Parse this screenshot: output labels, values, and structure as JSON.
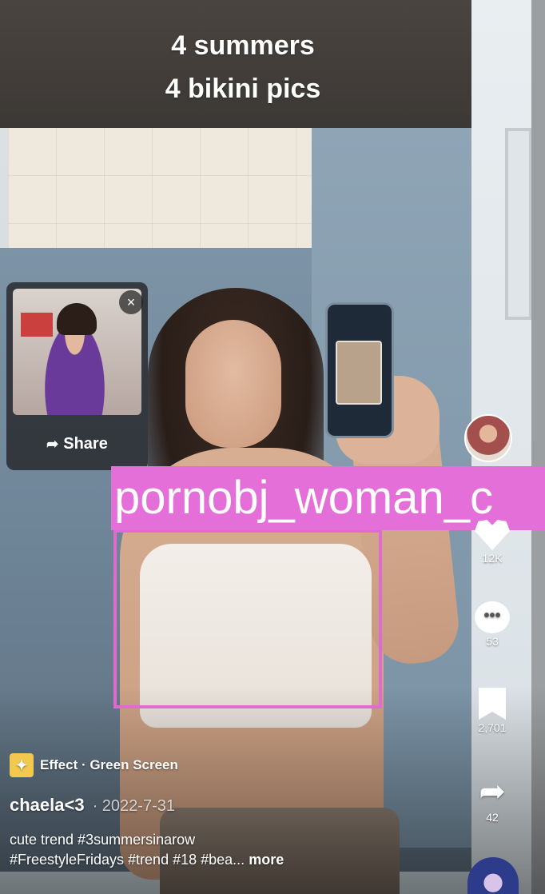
{
  "video": {
    "caption_line1": "4 summers",
    "caption_line2": "4 bikini pics"
  },
  "share_card": {
    "close_icon": "close-icon",
    "close_glyph": "×",
    "button_label": "Share",
    "button_icon": "share-arrow-icon"
  },
  "detection": {
    "label": "pornobj_woman_c",
    "color": "#e56fd8"
  },
  "actions": {
    "like_count": "12K",
    "comment_count": "53",
    "bookmark_count": "2,701",
    "share_count": "42"
  },
  "post": {
    "effect_label": "Effect · Green Screen",
    "author": "chaela<3",
    "date": "· 2022-7-31",
    "desc_line1": "cute trend #3summersinarow",
    "desc_line2": "#FreestyleFridays #trend #18 #bea...",
    "more_label": "more"
  },
  "colors": {
    "accent": "#e56fd8",
    "effect_icon": "#f2c94c"
  }
}
